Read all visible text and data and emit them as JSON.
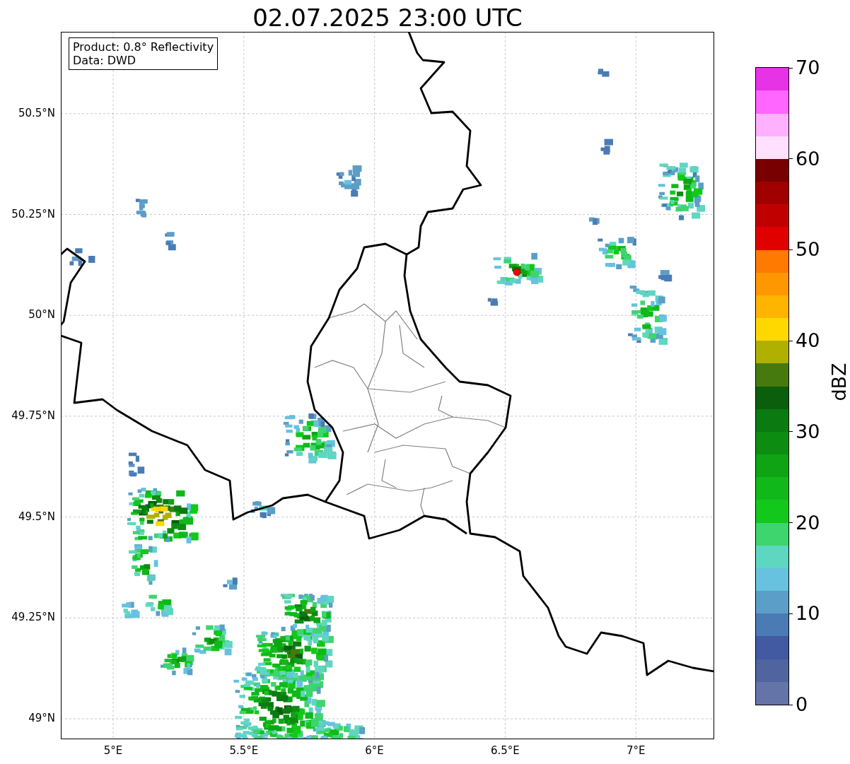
{
  "title": "02.07.2025 23:00 UTC",
  "info_box": [
    "Product: 0.8° Reflectivity",
    "Data: DWD"
  ],
  "map": {
    "lat_ticks": [
      "50.5°N",
      "50.25°N",
      "50°N",
      "49.75°N",
      "49.5°N",
      "49.25°N",
      "49°N"
    ],
    "lon_ticks": [
      "5°E",
      "5.5°E",
      "6°E",
      "6.5°E",
      "7°E"
    ]
  },
  "colorbar": {
    "label": "dBZ",
    "ticks": [
      "70",
      "60",
      "50",
      "40",
      "30",
      "20",
      "10",
      "0"
    ],
    "bands": [
      {
        "color": "#6474a8"
      },
      {
        "color": "#5064a0"
      },
      {
        "color": "#415aa2"
      },
      {
        "color": "#4a7bb4"
      },
      {
        "color": "#5b9ec8"
      },
      {
        "color": "#66c2de"
      },
      {
        "color": "#5fd6c0"
      },
      {
        "color": "#3ed46e"
      },
      {
        "color": "#12c81a"
      },
      {
        "color": "#10b81a"
      },
      {
        "color": "#0ea414"
      },
      {
        "color": "#0d8c12"
      },
      {
        "color": "#0b7a10"
      },
      {
        "color": "#0a5e0c"
      },
      {
        "color": "#467a0e"
      },
      {
        "color": "#b0b000"
      },
      {
        "color": "#ffd800"
      },
      {
        "color": "#ffb400"
      },
      {
        "color": "#ff9800"
      },
      {
        "color": "#ff7a00"
      },
      {
        "color": "#e00000"
      },
      {
        "color": "#c00000"
      },
      {
        "color": "#a00000"
      },
      {
        "color": "#780000"
      },
      {
        "color": "#ffe0ff"
      },
      {
        "color": "#ffb0ff"
      },
      {
        "color": "#ff66ff"
      },
      {
        "color": "#e633e6"
      }
    ]
  }
}
